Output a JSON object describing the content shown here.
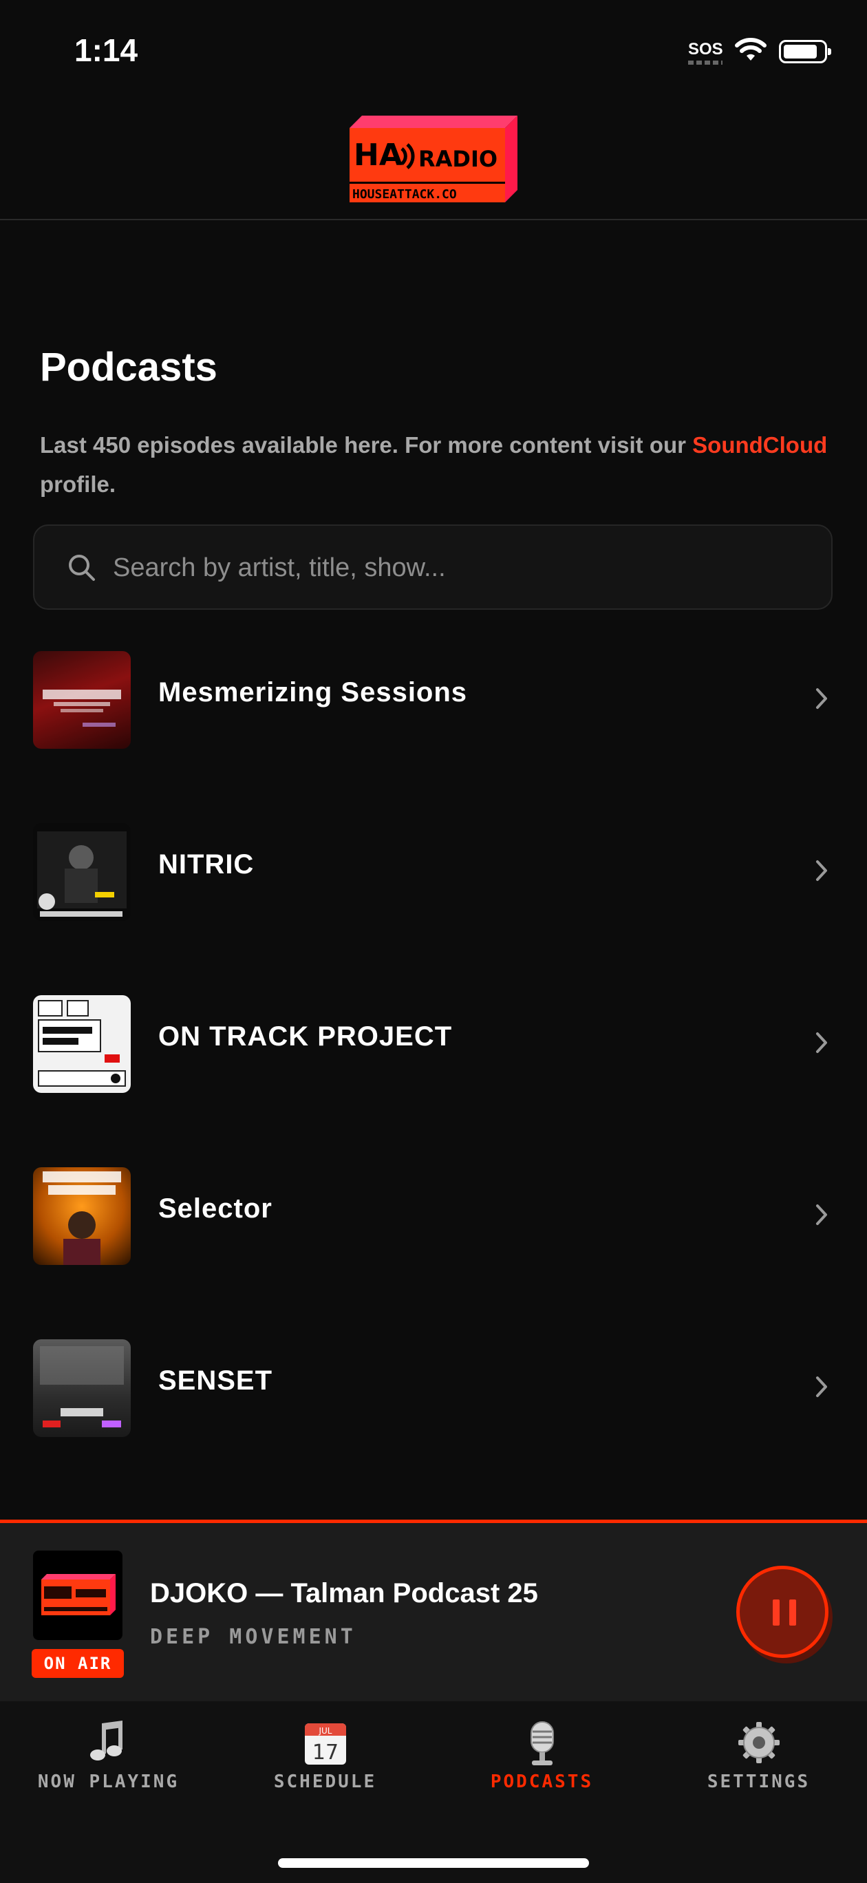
{
  "status": {
    "time": "1:14",
    "sos": "SOS"
  },
  "header": {
    "logo_text": "RADIO",
    "logo_sub": "HOUSEATTACK.CO"
  },
  "page": {
    "title": "Podcasts",
    "subtitle_before": "Last 450 episodes available here. For more content visit our ",
    "subtitle_link": "SoundCloud",
    "subtitle_after": " profile."
  },
  "search": {
    "placeholder": "Search by artist, title, show..."
  },
  "podcasts": [
    {
      "title": "Mesmerizing Sessions"
    },
    {
      "title": "NITRIC"
    },
    {
      "title": "ON TRACK PROJECT"
    },
    {
      "title": "Selector"
    },
    {
      "title": "SENSET"
    }
  ],
  "player": {
    "title": "DJOKO — Talman Podcast 25",
    "subtitle": "DEEP MOVEMENT",
    "badge": "ON AIR"
  },
  "tabs": [
    {
      "label": "NOW PLAYING",
      "icon": "music-note-icon"
    },
    {
      "label": "SCHEDULE",
      "icon": "calendar-icon",
      "cal_month": "JUL",
      "cal_day": "17"
    },
    {
      "label": "PODCASTS",
      "icon": "microphone-icon"
    },
    {
      "label": "SETTINGS",
      "icon": "gear-icon"
    }
  ],
  "colors": {
    "accent": "#ff2a00",
    "background": "#0c0c0c",
    "muted_text": "#a8a8a8"
  }
}
